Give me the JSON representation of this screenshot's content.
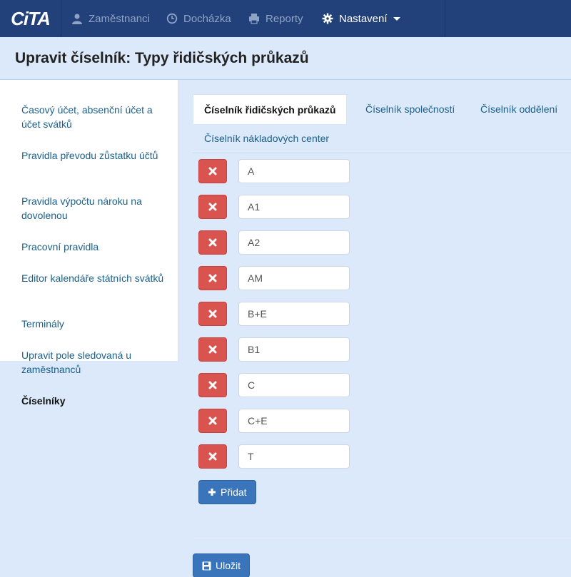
{
  "brand": {
    "logo_text": "CiTA"
  },
  "nav": {
    "items": [
      {
        "label": "Zaměstnanci",
        "icon": "user-icon"
      },
      {
        "label": "Docházka",
        "icon": "clock-icon"
      },
      {
        "label": "Reporty",
        "icon": "printer-icon"
      },
      {
        "label": "Nastavení",
        "icon": "gear-icon"
      }
    ]
  },
  "page": {
    "title": "Upravit číselník: Typy řidičských průkazů"
  },
  "sidebar": {
    "items": [
      {
        "label": "Časový účet, absenční účet a účet svátků"
      },
      {
        "label": "Pravidla převodu zůstatku účtů"
      },
      {
        "label": "Pravidla výpočtu nároku na dovolenou"
      },
      {
        "label": "Pracovní pravidla"
      },
      {
        "label": "Editor kalendáře státních svátků"
      },
      {
        "label": "Terminály"
      },
      {
        "label": "Upravit pole sledovaná u zaměstnanců"
      },
      {
        "label": "Číselníky"
      }
    ]
  },
  "tabs": [
    {
      "label": "Číselník řidičských průkazů"
    },
    {
      "label": "Číselník společností"
    },
    {
      "label": "Číselník oddělení"
    },
    {
      "label": "Číselník nákladových center"
    }
  ],
  "entries": [
    {
      "value": "A"
    },
    {
      "value": "A1"
    },
    {
      "value": "A2"
    },
    {
      "value": "AM"
    },
    {
      "value": "B+E"
    },
    {
      "value": "B1"
    },
    {
      "value": "C"
    },
    {
      "value": "C+E"
    },
    {
      "value": "T"
    }
  ],
  "actions": {
    "add_label": "Přidat",
    "save_label": "Uložit"
  },
  "colors": {
    "navbar": "#22407a",
    "danger": "#d9534f",
    "primary": "#3a74ba",
    "background": "#dbe9fb"
  }
}
